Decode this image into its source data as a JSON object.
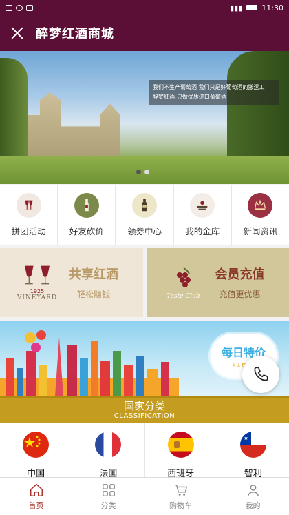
{
  "status_bar": {
    "time": "11:30"
  },
  "header": {
    "title": "醉梦红酒商城"
  },
  "banner": {
    "quote_line1": "我们不生产葡萄酒 我们只是好葡萄酒的搬运工",
    "quote_line2": "醉梦红酒-只做优质进口葡萄酒"
  },
  "menu": {
    "items": [
      {
        "label": "拼团活动",
        "icon": "wine-logo-icon",
        "color": "#f1e8e2"
      },
      {
        "label": "好友砍价",
        "icon": "wine-bottle-icon",
        "color": "#7b8a4a"
      },
      {
        "label": "领券中心",
        "icon": "wine-pour-icon",
        "color": "#ede6c9"
      },
      {
        "label": "我的金库",
        "icon": "vineyard-icon",
        "color": "#f4ece6"
      },
      {
        "label": "新闻资讯",
        "icon": "crown-icon",
        "color": "#9b3043"
      }
    ]
  },
  "promos": {
    "share": {
      "title": "共享红酒",
      "subtitle": "轻松赚钱",
      "logo_year": "1925",
      "logo_text": "VINEYARD"
    },
    "member": {
      "title": "会员充值",
      "subtitle": "充值更优惠",
      "logo_text": "Taste Club"
    }
  },
  "special": {
    "title": "每日特价",
    "subtitle": "天天有好价"
  },
  "section": {
    "title": "国家分类",
    "subtitle": "CLASSIFICATION"
  },
  "countries": [
    {
      "label": "中国",
      "flag": "china-flag-icon"
    },
    {
      "label": "法国",
      "flag": "france-flag-icon"
    },
    {
      "label": "西班牙",
      "flag": "spain-flag-icon"
    },
    {
      "label": "智利",
      "flag": "chile-flag-icon"
    }
  ],
  "tabbar": {
    "items": [
      {
        "label": "首页",
        "icon": "home-icon",
        "active": true
      },
      {
        "label": "分类",
        "icon": "grid-icon",
        "active": false
      },
      {
        "label": "购物车",
        "icon": "cart-icon",
        "active": false
      },
      {
        "label": "我的",
        "icon": "user-icon",
        "active": false
      }
    ]
  },
  "colors": {
    "brand": "#5c0f36",
    "section": "#c49d20",
    "active_tab": "#a8322a"
  }
}
